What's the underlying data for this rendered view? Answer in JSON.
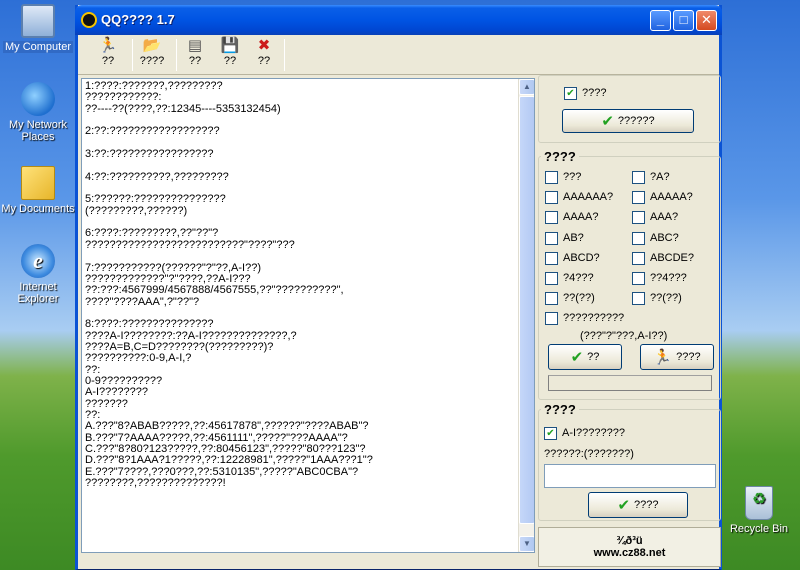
{
  "desktop": {
    "icons": [
      {
        "label": "My Computer"
      },
      {
        "label": "My Network Places"
      },
      {
        "label": "My Documents"
      },
      {
        "label": "Internet Explorer"
      },
      {
        "label": "Recycle Bin"
      }
    ]
  },
  "window": {
    "title": "QQ???? 1.7",
    "controls": {
      "minimize": "_",
      "maximize": "□",
      "close": "✕"
    }
  },
  "toolbar": {
    "items": [
      {
        "label": "??",
        "icon": "run-icon"
      },
      {
        "label": "????",
        "icon": "open-folder-icon"
      },
      {
        "label": "??",
        "icon": "list-icon"
      },
      {
        "label": "??",
        "icon": "save-icon"
      },
      {
        "label": "??",
        "icon": "close-icon"
      }
    ]
  },
  "textpane": {
    "content": "1:????:???????,?????????\n????????????:\n??----??(????,??:12345----5353132454)\n\n2:??:??????????????????\n\n3:??:?????????????????\n\n4:??:??????????,?????????\n\n5:??????:???????????????\n(?????????,??????)\n\n6:????:?????????,??\"??\"?\n??????????????????????????\"????\"???\n\n7:???????????(??????\"?\"??,A-I??)\n?????????????\"?\"????,??A-I???\n??:???:4567999/4567888/4567555,??\"??????????\",\n????\"????AAA\",?\"??\"?\n\n8:????:???????????????\n????A-I????????:??A-I??????????????,?\n????A=B,C=D????????(?????????)?\n??????????:0-9,A-I,?\n??:\n0-9??????????\nA-I????????\n???????\n??:\nA.???\"8?ABAB?????,??:45617878\",??????\"????ABAB\"?\nB.???\"7?AAAA?????,??:4561111\",?????\"???AAAA\"?\nC.???\"8?80?123?????,??:80456123\",?????\"80???123\"?\nD.???\"8?1AAA?1?????,??:12228981\",?????\"1AAA???1\"?\nE.???\"7????,???0???,??:5310135\",?????\"ABC0CBA\"?\n????????,??????????????!"
  },
  "right_panel": {
    "top_checkbox": {
      "label": "????",
      "checked": true
    },
    "top_button": "??????",
    "options_group": {
      "title": "????",
      "items": [
        {
          "label": "???",
          "checked": false
        },
        {
          "label": "?A?",
          "checked": false
        },
        {
          "label": "AAAAAA?",
          "checked": false
        },
        {
          "label": "AAAAA?",
          "checked": false
        },
        {
          "label": "AAAA?",
          "checked": false
        },
        {
          "label": "AAA?",
          "checked": false
        },
        {
          "label": "AB?",
          "checked": false
        },
        {
          "label": "ABC?",
          "checked": false
        },
        {
          "label": "ABCD?",
          "checked": false
        },
        {
          "label": "ABCDE?",
          "checked": false
        },
        {
          "label": "?4???",
          "checked": false
        },
        {
          "label": "??4???",
          "checked": false
        },
        {
          "label": "??(??)",
          "checked": false
        },
        {
          "label": "??(??)",
          "checked": false
        },
        {
          "label": "??????????",
          "checked": false
        }
      ],
      "note": "(???\"?\"???,A-I??)",
      "button_ok": "??",
      "button_run": "????"
    },
    "custom_group": {
      "title": "????",
      "checkbox": {
        "label": "A-I????????",
        "checked": true
      },
      "input_label": "??????:(???????)",
      "input_value": "",
      "button": "????"
    },
    "logo": {
      "line1": "¾ð³ü",
      "line2": "www.cz88.net"
    }
  }
}
